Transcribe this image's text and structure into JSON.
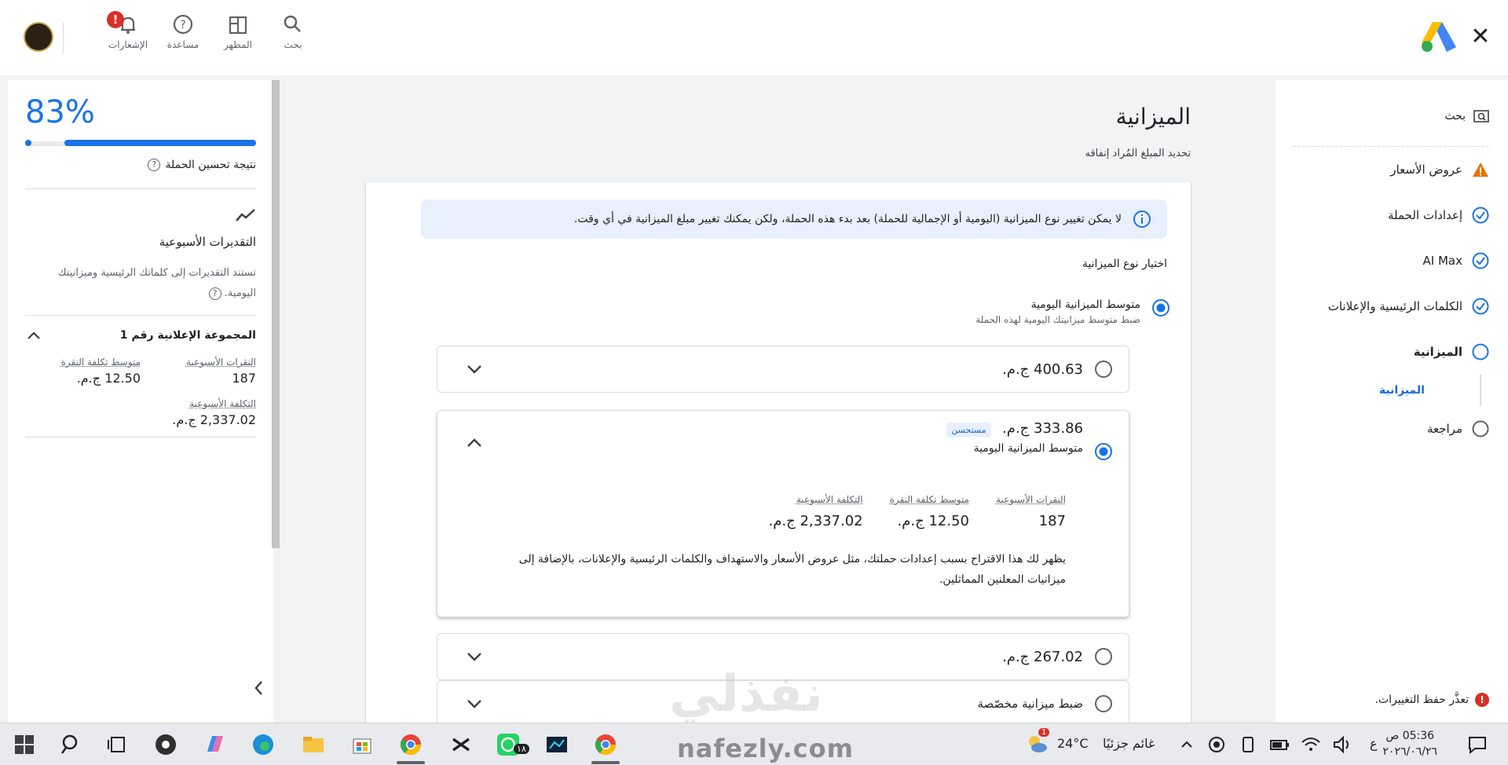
{
  "topbar": {
    "search_label": "بحث",
    "appearance_label": "المظهر",
    "help_label": "مساعدة",
    "notifications_label": "الإشعارات",
    "notification_badge": "!"
  },
  "left_panel": {
    "optimization_score": "83%",
    "optimization_progress": 0.83,
    "optimization_label": "نتيجة تحسين الحملة",
    "weekly_title": "التقديرات الأسبوعية",
    "weekly_desc": "تستند التقديرات إلى كلماتك الرئيسية وميزانيتك اليومية.",
    "ad_group_title": "المجموعة الإعلانية رقم 1",
    "metrics": {
      "clicks_label": "النقرات الأسبوعية",
      "clicks_value": "187",
      "cpc_label": "متوسط تكلفة النقرة",
      "cpc_value": "12.50 ج.م.",
      "cost_label": "التكلفة الأسبوعية",
      "cost_value": "2,337.02 ج.م."
    }
  },
  "right_nav": {
    "search_label": "بحث",
    "items": [
      {
        "label": "عروض الأسعار",
        "status": "warning"
      },
      {
        "label": "إعدادات الحملة",
        "status": "done"
      },
      {
        "label": "AI Max",
        "status": "done"
      },
      {
        "label": "الكلمات الرئيسية والإعلانات",
        "status": "done"
      },
      {
        "label": "الميزانية",
        "status": "current"
      },
      {
        "label": "مراجعة",
        "status": "todo"
      }
    ],
    "sub_item": "الميزانية",
    "error_message": "تعذَّر حفظ التغييرات."
  },
  "main": {
    "title": "الميزانية",
    "subtitle": "تحديد المبلغ المُراد إنفاقه",
    "info_banner": "لا يمكن تغيير نوع الميزانية (اليومية أو الإجمالية للحملة) بعد بدء هذه الحملة، ولكن يمكنك تغيير مبلغ الميزانية في أي وقت.",
    "budget_type_label": "اختيار نوع الميزانية",
    "budget_type_option": "متوسط الميزانية اليومية",
    "budget_type_desc": "ضبط متوسط ميزانيتك اليومية لهذه الحملة",
    "options": [
      {
        "amount": "400.63 ج.م.",
        "selected": false
      },
      {
        "amount": "333.86 ج.م.",
        "selected": true,
        "badge": "مستحسن",
        "sub": "متوسط الميزانية اليومية"
      },
      {
        "amount": "267.02 ج.م.",
        "selected": false
      },
      {
        "amount": "ضبط ميزانية مخصّصة",
        "selected": false
      }
    ],
    "expanded": {
      "clicks_label": "النقرات الأسبوعية",
      "clicks_value": "187",
      "cpc_label": "متوسط تكلفة النقرة",
      "cpc_value": "12.50 ج.م.",
      "cost_label": "التكلفة الأسبوعية",
      "cost_value": "2,337.02 ج.م.",
      "description": "يظهر لك هذا الاقتراح بسبب إعدادات حملتك، مثل عروض الأسعار والاستهداف والكلمات الرئيسية والإعلانات، بالإضافة إلى ميزانيات المعلنين المماثلين."
    }
  },
  "watermark": {
    "arabic": "نفذلي",
    "latin": "nafezly.com"
  },
  "taskbar": {
    "weather_temp": "24°C",
    "weather_desc": "غائم جزئيًا",
    "language": "ع",
    "time": "05:36 ص",
    "date": "٢٠٢٦/٠٦/٢٦",
    "whatsapp_badge": "١٨",
    "weather_badge": "1"
  },
  "colors": {
    "accent": "#1a73e8",
    "warning": "#e37400",
    "error": "#d93025"
  }
}
